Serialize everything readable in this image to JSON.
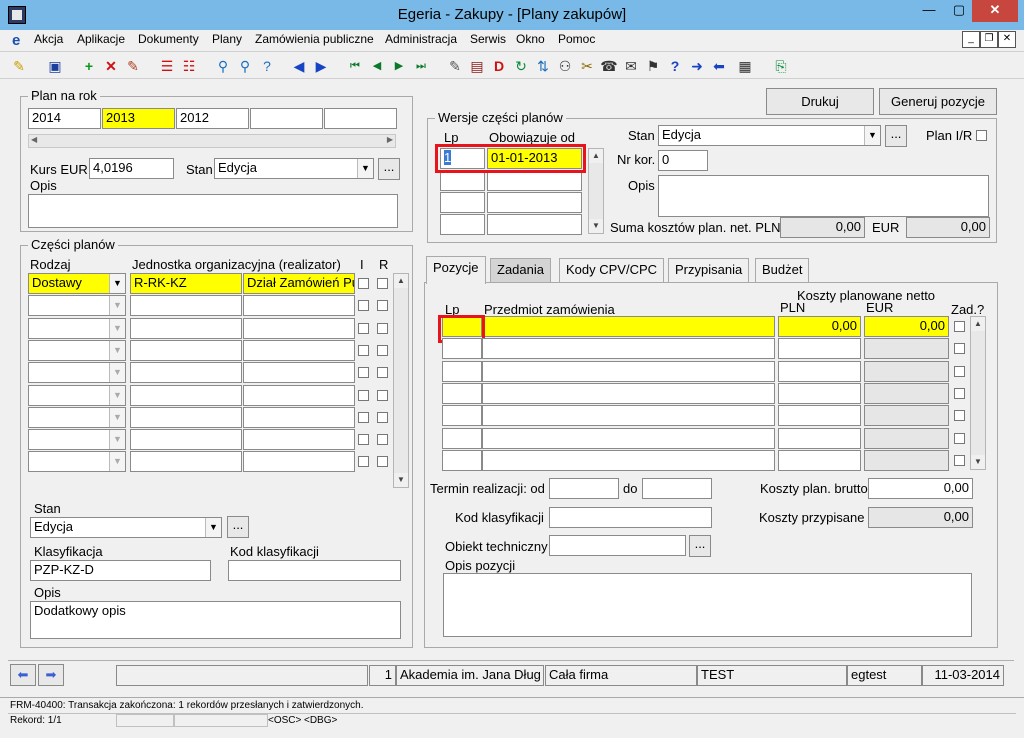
{
  "window": {
    "title": "Egeria - Zakupy - [Plany zakupów]"
  },
  "menu": [
    "Akcja",
    "Aplikacje",
    "Dokumenty",
    "Plany",
    "Zamówienia publiczne",
    "Administracja",
    "Serwis",
    "Okno",
    "Pomoc"
  ],
  "plan_na_rok": {
    "legend": "Plan na rok",
    "years": [
      "2014",
      "2013",
      "2012",
      "",
      ""
    ],
    "kurs_label": "Kurs EUR",
    "kurs_value": "4,0196",
    "stan_label": "Stan",
    "stan_value": "Edycja",
    "opis_label": "Opis",
    "opis_value": ""
  },
  "buttons": {
    "drukuj": "Drukuj",
    "generuj": "Generuj pozycje",
    "ellipsis": "..."
  },
  "wersje": {
    "legend": "Wersje części planów",
    "col_lp": "Lp",
    "col_obowiazuje": "Obowiązuje od",
    "rows": [
      {
        "lp": "1",
        "od": "01-01-2013"
      },
      {
        "lp": "",
        "od": ""
      },
      {
        "lp": "",
        "od": ""
      },
      {
        "lp": "",
        "od": ""
      }
    ],
    "stan_label": "Stan",
    "stan_value": "Edycja",
    "plan_ir_label": "Plan I/R",
    "nr_kor_label": "Nr kor.",
    "nr_kor_value": "0",
    "opis_label": "Opis",
    "suma_label": "Suma kosztów plan. net. PLN",
    "suma_pln": "0,00",
    "eur_label": "EUR",
    "suma_eur": "0,00"
  },
  "czesci": {
    "legend": "Części planów",
    "col_rodzaj": "Rodzaj",
    "col_jednostka": "Jednostka organizacyjna (realizator)",
    "col_i": "I",
    "col_r": "R",
    "first_row": {
      "rodzaj": "Dostawy",
      "jednostka": "R-RK-KZ",
      "dzial": "Dział Zamówień Pu"
    },
    "stan_label": "Stan",
    "stan_value": "Edycja",
    "klasyfikacja_label": "Klasyfikacja",
    "klasyfikacja_value": "PZP-KZ-D",
    "kod_klas_label": "Kod klasyfikacji",
    "opis_label": "Opis",
    "opis_value": "Dodatkowy opis"
  },
  "tabs": [
    "Pozycje",
    "Zadania",
    "Kody CPV/CPC",
    "Przypisania",
    "Budżet"
  ],
  "pozycje": {
    "col_lp": "Lp",
    "col_przedmiot": "Przedmiot zamówienia",
    "col_koszty": "Koszty planowane netto",
    "col_pln": "PLN",
    "col_eur": "EUR",
    "col_zad": "Zad.?",
    "first_pln": "0,00",
    "first_eur": "0,00",
    "termin_label": "Termin realizacji: od",
    "do_label": "do",
    "koszty_brutto_label": "Koszty plan. brutto",
    "koszty_brutto_value": "0,00",
    "kod_klas_label": "Kod klasyfikacji",
    "koszty_przyp_label": "Koszty przypisane",
    "koszty_przyp_value": "0,00",
    "obiekt_label": "Obiekt techniczny",
    "opis_pozycji_label": "Opis pozycji"
  },
  "status": {
    "count": "1",
    "org": "Akademia im. Jana Dług",
    "firma": "Cała firma",
    "env": "TEST",
    "user": "egtest",
    "date": "11-03-2014",
    "message": "FRM-40400: Transakcja zakończona: 1 rekordów przesłanych i zatwierdzonych.",
    "rekord": "Rekord: 1/1",
    "osc": "<OSC>",
    "dbg": "<DBG>"
  }
}
